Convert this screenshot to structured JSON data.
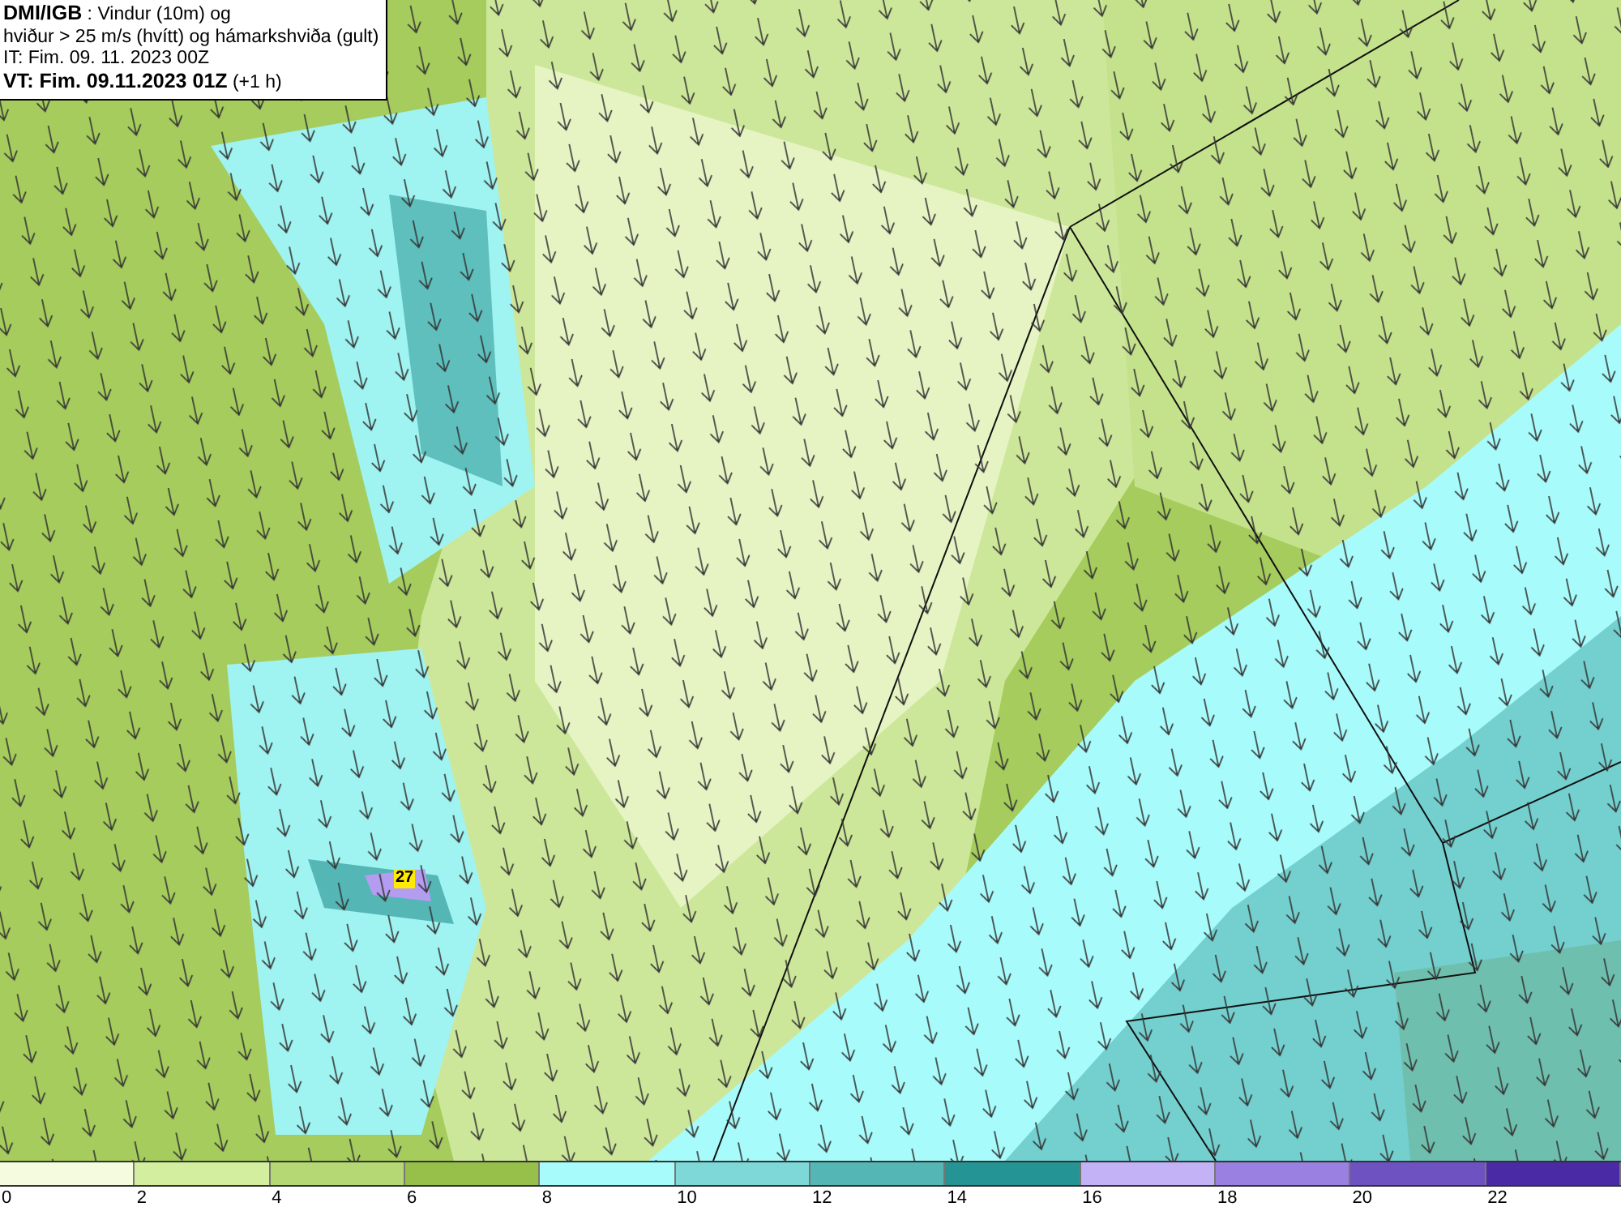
{
  "info_box": {
    "lines": [
      "**DMI/IGB** : Vindur (10m) og",
      "hviður > 25 m/s (hvítt) og hámarkshviða (gult)",
      "IT: Fim. 09. 11. 2023 00Z",
      "**VT: Fim. 09.11.2023 01Z** (+1 h)"
    ]
  },
  "gust_marker": {
    "label": "27"
  },
  "legend": {
    "swatches": [
      {
        "color": "#f5fbdf"
      },
      {
        "color": "#d4eea0"
      },
      {
        "color": "#b5d774"
      },
      {
        "color": "#97c04a"
      },
      {
        "color": "#a8fbfb"
      },
      {
        "color": "#7fd8d8"
      },
      {
        "color": "#55b6b6"
      },
      {
        "color": "#259494"
      },
      {
        "color": "#c3b2f6"
      },
      {
        "color": "#9a80e0"
      },
      {
        "color": "#6f52c2"
      },
      {
        "color": "#4a2ba5"
      }
    ],
    "ticks": [
      "0",
      "2",
      "4",
      "6",
      "8",
      "10",
      "12",
      "14",
      "16",
      "18",
      "20",
      "22"
    ]
  }
}
